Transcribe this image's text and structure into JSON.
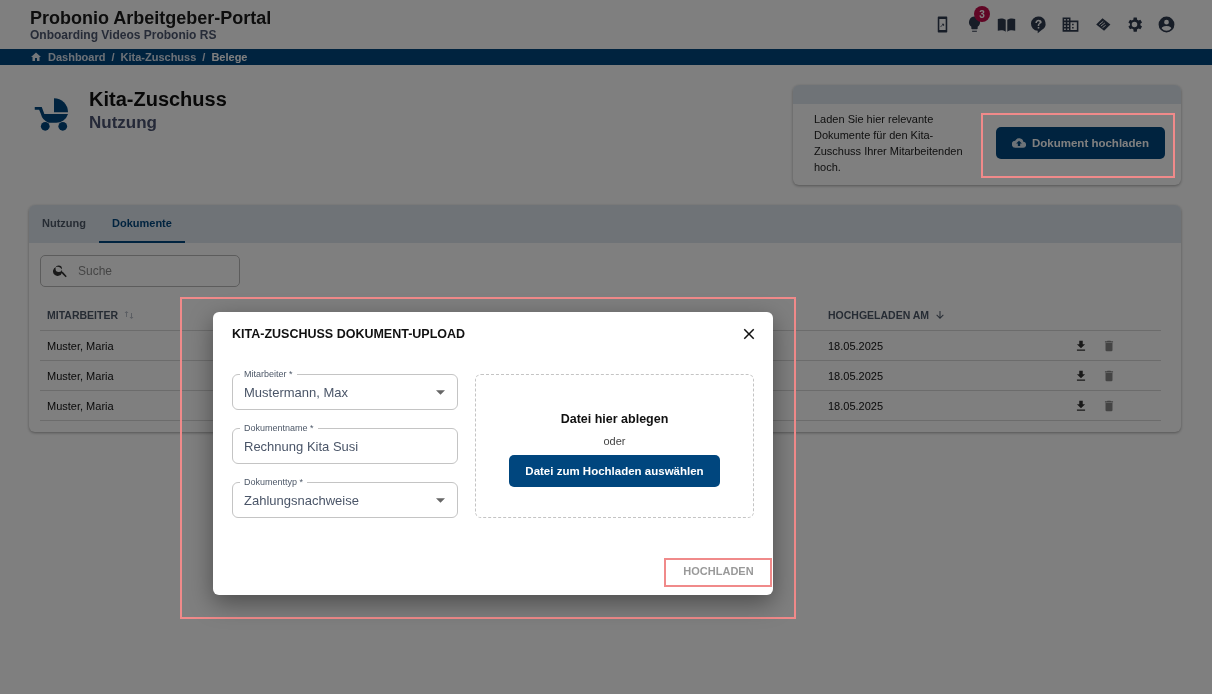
{
  "header": {
    "title": "Probonio Arbeitgeber-Portal",
    "subtitle": "Onboarding Videos Probonio RS",
    "notification_count": "3"
  },
  "breadcrumb": [
    {
      "label": "Dashboard"
    },
    {
      "separator": "/",
      "label": "Kita-Zuschuss"
    },
    {
      "separator": "/",
      "label": "Belege"
    }
  ],
  "page": {
    "title": "Kita-Zuschuss",
    "subtitle": "Nutzung"
  },
  "info_card": {
    "text": "Laden Sie hier relevante Dokumente für den Kita-Zuschuss Ihrer Mitarbeitenden hoch.",
    "button": "Dokument hochladen"
  },
  "tabs": [
    {
      "label": "Nutzung",
      "selected": false
    },
    {
      "label": "Dokumente",
      "selected": true
    }
  ],
  "search": {
    "placeholder": "Suche"
  },
  "table": {
    "columns": [
      {
        "label": "MITARBEITER",
        "sorted": false
      },
      {
        "label": "HOCHGELADEN AM",
        "sorted": true
      }
    ],
    "rows": [
      {
        "employee": "Muster, Maria",
        "uploaded": "18.05.2025"
      },
      {
        "employee": "Muster, Maria",
        "uploaded": "18.05.2025"
      },
      {
        "employee": "Muster, Maria",
        "uploaded": "18.05.2025"
      }
    ]
  },
  "dialog": {
    "title": "KITA-ZUSCHUSS DOKUMENT-UPLOAD",
    "fields": [
      {
        "kind": "select",
        "label": "Mitarbeiter *",
        "value": "Mustermann, Max"
      },
      {
        "kind": "text",
        "label": "Dokumentname *",
        "value": "Rechnung Kita Susi"
      },
      {
        "kind": "select",
        "label": "Dokumenttyp *",
        "value": "Zahlungsnachweise"
      }
    ],
    "dropzone": {
      "title": "Datei hier ablegen",
      "or": "oder",
      "button": "Datei zum Hochladen auswählen"
    },
    "submit": {
      "label": "HOCHLADEN",
      "disabled": true
    }
  }
}
